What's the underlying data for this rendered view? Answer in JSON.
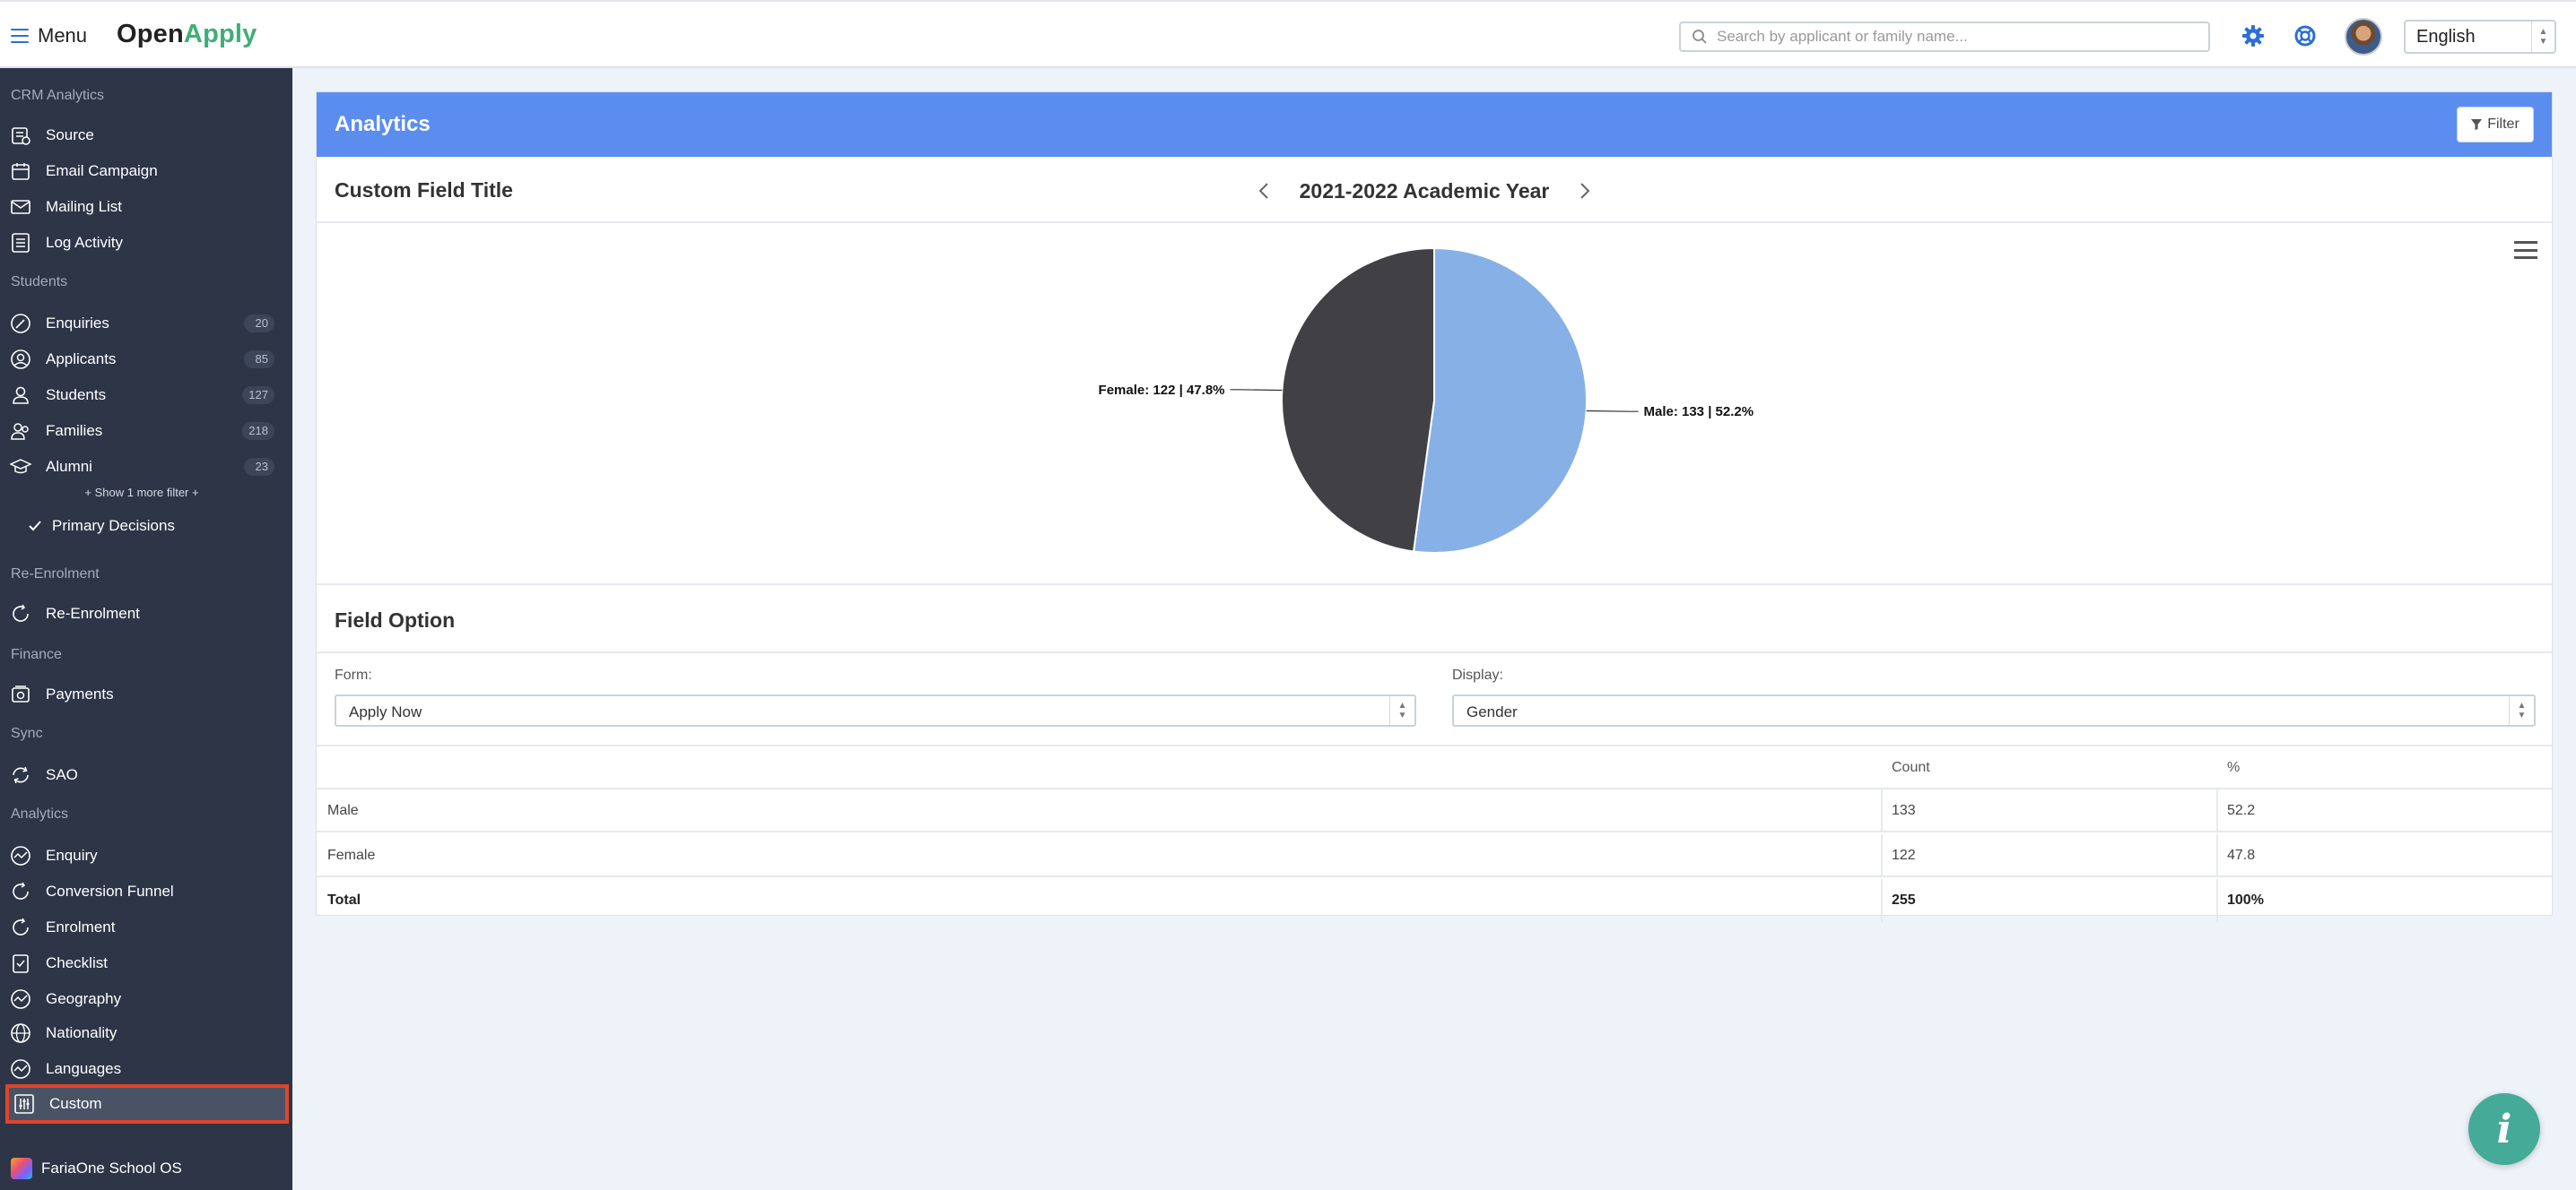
{
  "topbar": {
    "menu_label": "Menu",
    "logo_open": "Open",
    "logo_apply": "Apply",
    "search_placeholder": "Search by applicant or family name...",
    "language": "English"
  },
  "sidebar": {
    "sections": {
      "crm": "CRM Analytics",
      "students": "Students",
      "reenrol": "Re-Enrolment",
      "finance": "Finance",
      "sync": "Sync",
      "analytics": "Analytics"
    },
    "crm_items": [
      {
        "label": "Source",
        "icon": "source-icon"
      },
      {
        "label": "Email Campaign",
        "icon": "calendar-icon"
      },
      {
        "label": "Mailing List",
        "icon": "mail-icon"
      },
      {
        "label": "Log Activity",
        "icon": "list-icon"
      }
    ],
    "student_items": [
      {
        "label": "Enquiries",
        "count": "20",
        "icon": "pen-icon"
      },
      {
        "label": "Applicants",
        "count": "85",
        "icon": "user-circle-icon"
      },
      {
        "label": "Students",
        "count": "127",
        "icon": "user-icon"
      },
      {
        "label": "Families",
        "count": "218",
        "icon": "family-icon"
      },
      {
        "label": "Alumni",
        "count": "23",
        "icon": "graduation-icon"
      }
    ],
    "show_more": "+ Show 1 more filter +",
    "primary_decisions": "Primary Decisions",
    "reenrol_items": [
      {
        "label": "Re-Enrolment",
        "icon": "refresh-icon"
      }
    ],
    "finance_items": [
      {
        "label": "Payments",
        "icon": "payment-icon"
      }
    ],
    "sync_items": [
      {
        "label": "SAO",
        "icon": "sync-icon"
      }
    ],
    "analytics_items": [
      {
        "label": "Enquiry",
        "icon": "chart-line-icon"
      },
      {
        "label": "Conversion Funnel",
        "icon": "refresh-icon"
      },
      {
        "label": "Enrolment",
        "icon": "refresh-icon"
      },
      {
        "label": "Checklist",
        "icon": "checklist-icon"
      },
      {
        "label": "Geography",
        "icon": "chart-line-icon"
      },
      {
        "label": "Nationality",
        "icon": "globe-icon"
      },
      {
        "label": "Languages",
        "icon": "chart-line-icon"
      },
      {
        "label": "Custom",
        "icon": "sliders-icon"
      }
    ],
    "footer": "FariaOne School OS"
  },
  "panel": {
    "title": "Analytics",
    "filter_label": "Filter",
    "custom_field_title": "Custom Field Title",
    "academic_year": "2021-2022 Academic Year",
    "field_option_title": "Field Option",
    "form_label": "Form:",
    "form_value": "Apply Now",
    "display_label": "Display:",
    "display_value": "Gender"
  },
  "chart_data": {
    "type": "pie",
    "slices": [
      {
        "label": "Male",
        "value": 133,
        "percent": 52.2,
        "color": "#87b1e6",
        "text": "Male: 133 | 52.2%"
      },
      {
        "label": "Female",
        "value": 122,
        "percent": 47.8,
        "color": "#404045",
        "text": "Female: 122 | 47.8%"
      }
    ]
  },
  "table": {
    "headers": [
      "",
      "Count",
      "%"
    ],
    "rows": [
      [
        "Male",
        "133",
        "52.2"
      ],
      [
        "Female",
        "122",
        "47.8"
      ]
    ],
    "total": [
      "Total",
      "255",
      "100%"
    ]
  },
  "colors": {
    "accent": "#5b8def",
    "sidebar_bg": "#2d3547",
    "active_outline": "#e0442b",
    "fab": "#45aa98"
  },
  "fab_glyph": "i"
}
